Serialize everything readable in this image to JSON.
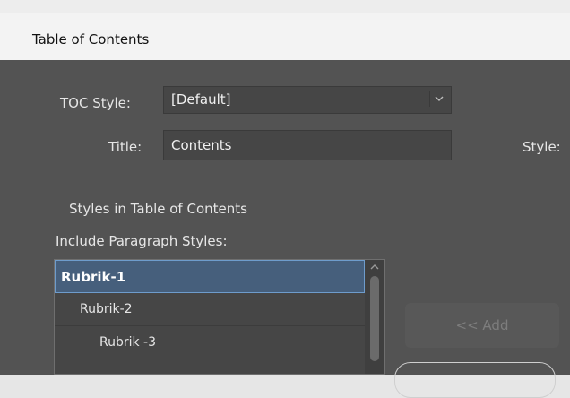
{
  "window": {
    "title": "Table of Contents"
  },
  "toc_style": {
    "label": "TOC Style:",
    "value": "[Default]"
  },
  "title_field": {
    "label": "Title:",
    "value": "Contents"
  },
  "style_label": "Style:",
  "section_heading": "Styles in Table of Contents",
  "include_label": "Include Paragraph Styles:",
  "paragraph_styles": [
    {
      "label": "Rubrik-1",
      "level": 1,
      "selected": true
    },
    {
      "label": "Rubrik-2",
      "level": 2,
      "selected": false
    },
    {
      "label": "Rubrik -3",
      "level": 3,
      "selected": false
    }
  ],
  "buttons": {
    "add": "<< Add"
  },
  "colors": {
    "panel_bg": "#535353",
    "field_bg": "#464646",
    "selection_bg": "#465f7c",
    "selection_border": "#6e9ccc"
  }
}
